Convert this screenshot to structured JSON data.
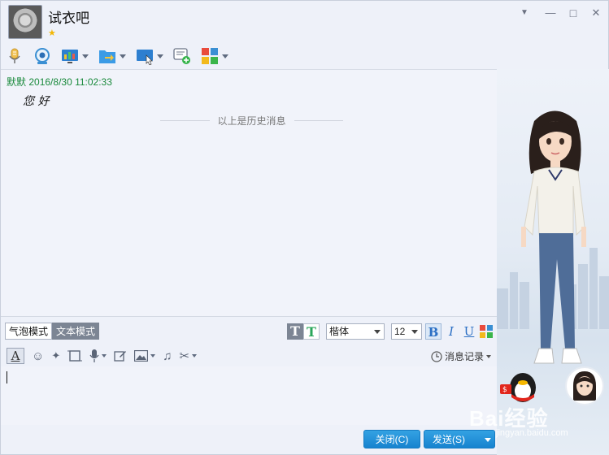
{
  "window": {
    "contact_name": "试衣吧",
    "star": "★",
    "controls": {
      "dropdown": "▼",
      "minimize": "—",
      "maximize": "□",
      "close": "✕"
    }
  },
  "toolbar": {
    "icons": [
      "microphone-icon",
      "video-camera-icon",
      "screen-share-icon",
      "file-transfer-icon",
      "remote-desktop-icon",
      "add-chat-icon",
      "apps-icon"
    ]
  },
  "messages": {
    "items": [
      {
        "sender": "默默",
        "time": "2016/8/30 11:02:33",
        "text": "您 好"
      }
    ],
    "history_note": "以上是历史消息"
  },
  "input_toolbar": {
    "mode_bubble": "气泡模式",
    "mode_text": "文本模式",
    "font_family": "楷体",
    "font_size": "12",
    "bold": "B",
    "italic": "I",
    "underline": "U",
    "history_label": "消息记录"
  },
  "buttons": {
    "close": "关闭(C)",
    "send": "发送(S)"
  },
  "watermark": {
    "brand": "Bai经验",
    "url": "jingyan.baidu.com"
  },
  "colors": {
    "accent": "#1783cf",
    "sender_green": "#1a8a3c"
  }
}
